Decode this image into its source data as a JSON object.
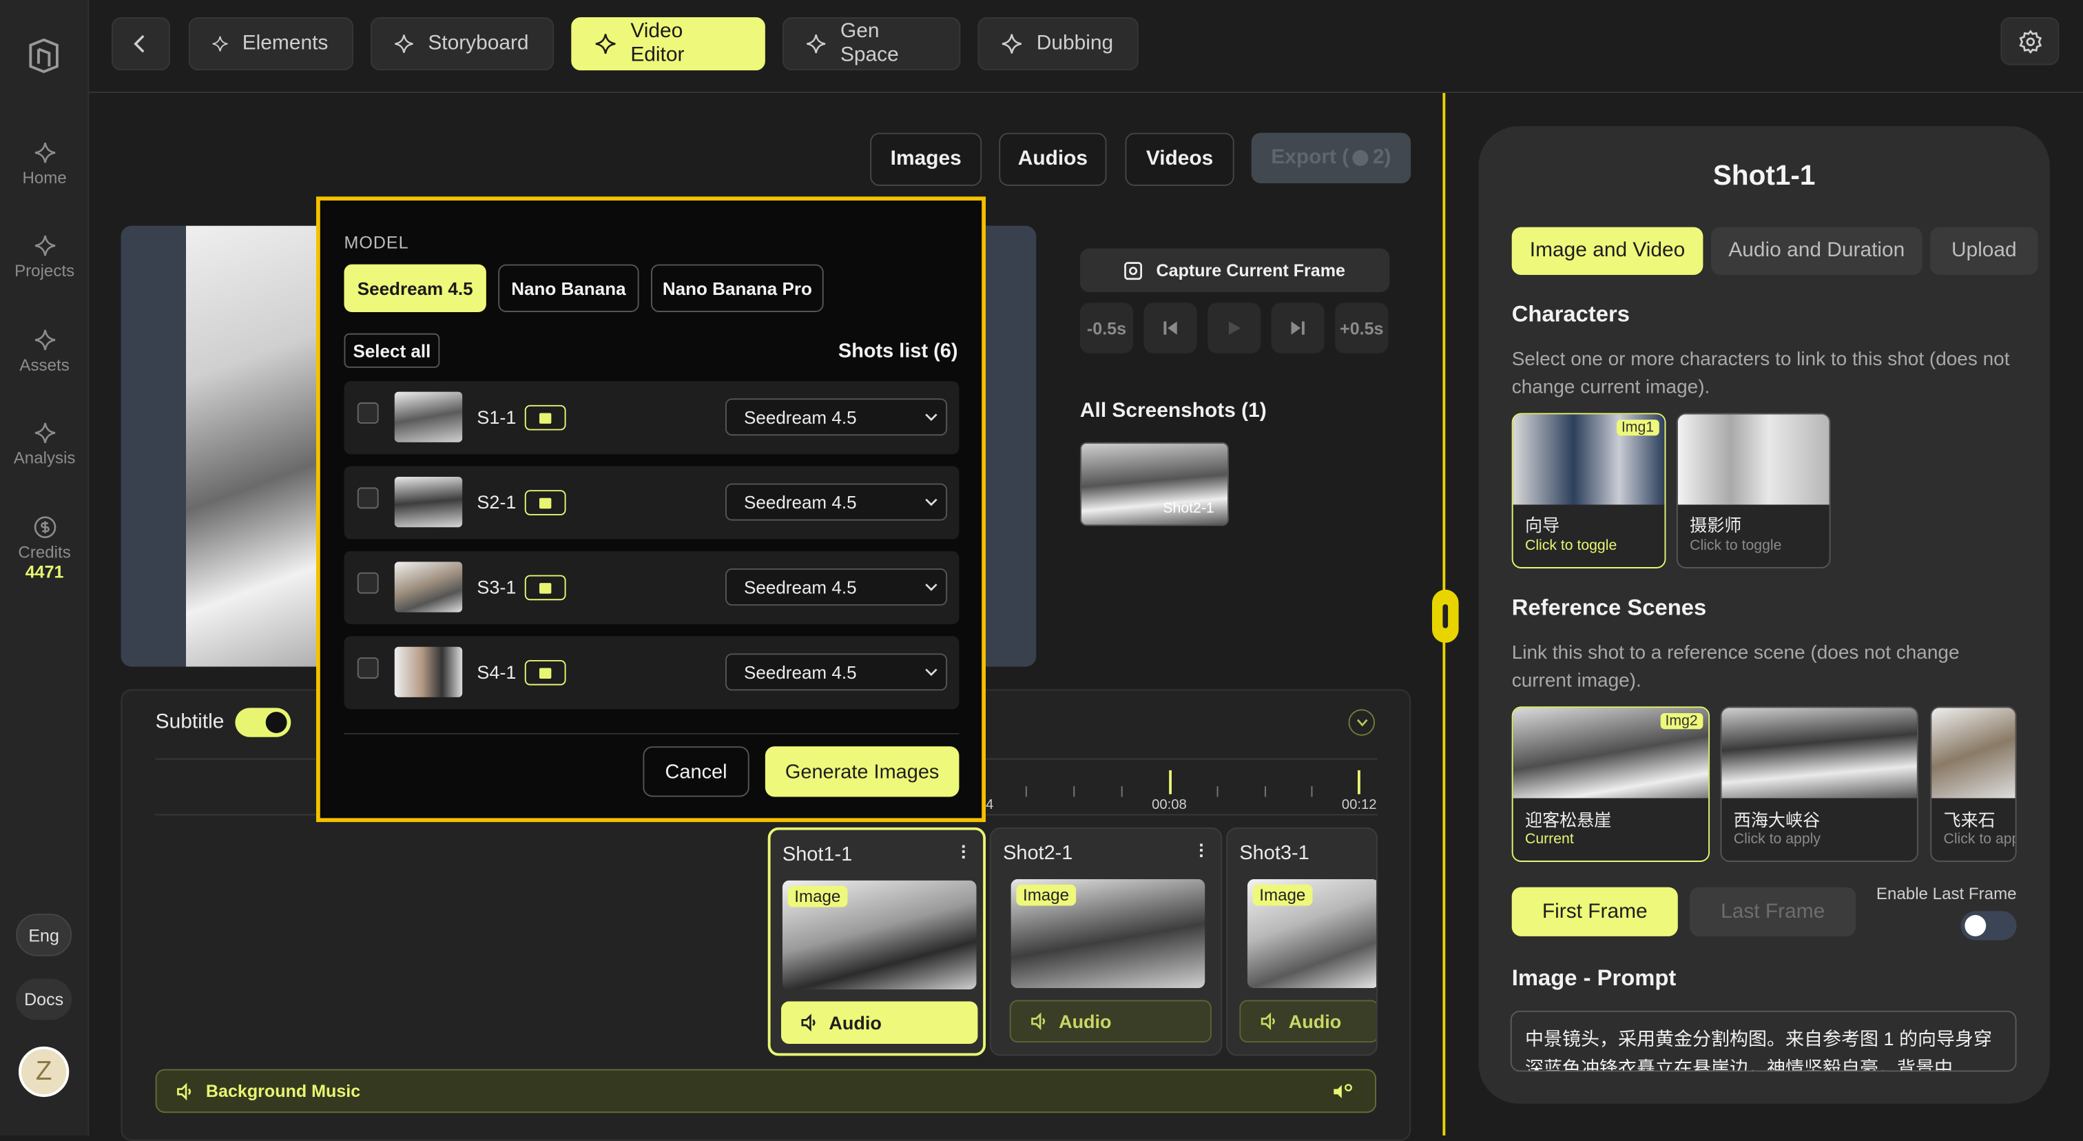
{
  "nav": {
    "home": "Home",
    "projects": "Projects",
    "assets": "Assets",
    "analysis": "Analysis",
    "credits": "Credits",
    "credits_value": "4471",
    "lang": "Eng",
    "docs": "Docs",
    "avatar": "Z"
  },
  "tabs": [
    "Elements",
    "Storyboard",
    "Video Editor",
    "Gen Space",
    "Dubbing"
  ],
  "media_buttons": {
    "images": "Images",
    "audios": "Audios",
    "videos": "Videos",
    "export": "Export (",
    "export_count": "2)"
  },
  "player": {
    "capture": "Capture Current Frame",
    "back": "-0.5s",
    "forward": "+0.5s"
  },
  "screenshots": {
    "title": "All Screenshots (1)",
    "items": [
      "Shot2-1"
    ]
  },
  "timeline": {
    "subtitle_label": "Subtitle",
    "subtitle_on": true,
    "ruler": [
      "4",
      "00:08",
      "00:12"
    ],
    "shots": [
      {
        "title": "Shot1-1",
        "tag": "Image",
        "audio": "Audio",
        "selected": true
      },
      {
        "title": "Shot2-1",
        "tag": "Image",
        "audio": "Audio",
        "selected": false
      },
      {
        "title": "Shot3-1",
        "tag": "Image",
        "audio": "Audio",
        "selected": false
      }
    ],
    "background_music": "Background Music"
  },
  "modal": {
    "model_label": "MODEL",
    "models": [
      "Seedream 4.5",
      "Nano Banana",
      "Nano Banana Pro"
    ],
    "active_model": "Seedream 4.5",
    "select_all": "Select all",
    "shots_list": "Shots list (6)",
    "rows": [
      {
        "name": "S1-1",
        "model": "Seedream 4.5"
      },
      {
        "name": "S2-1",
        "model": "Seedream 4.5"
      },
      {
        "name": "S3-1",
        "model": "Seedream 4.5"
      },
      {
        "name": "S4-1",
        "model": "Seedream 4.5"
      }
    ],
    "cancel": "Cancel",
    "generate": "Generate Images"
  },
  "panel": {
    "title": "Shot1-1",
    "tabs": [
      "Image and Video",
      "Audio and Duration",
      "Upload"
    ],
    "characters_title": "Characters",
    "characters_desc": "Select one or more characters to link to this shot (does not change current image).",
    "characters": [
      {
        "name": "向导",
        "sub": "Click to toggle",
        "tag": "Img1",
        "selected": true
      },
      {
        "name": "摄影师",
        "sub": "Click to toggle",
        "tag": "",
        "selected": false
      }
    ],
    "scenes_title": "Reference Scenes",
    "scenes_desc": "Link this shot to a reference scene (does not change current image).",
    "scenes": [
      {
        "name": "迎客松悬崖",
        "sub": "Current",
        "tag": "Img2",
        "selected": true
      },
      {
        "name": "西海大峡谷",
        "sub": "Click to apply",
        "tag": "",
        "selected": false
      },
      {
        "name": "飞来石",
        "sub": "Click to app",
        "tag": "",
        "selected": false
      }
    ],
    "first_frame": "First Frame",
    "last_frame": "Last Frame",
    "enable_last_frame": "Enable Last Frame",
    "prompt_title": "Image - Prompt",
    "prompt_text": "中景镜头，采用黄金分割构图。来自参考图 1 的向导身穿深蓝色冲锋衣矗立在悬崖边，神情坚毅自豪，背景中"
  },
  "colors": {
    "accent": "#eef87a",
    "modal_border": "#f5c000",
    "divider": "#e8d500"
  }
}
